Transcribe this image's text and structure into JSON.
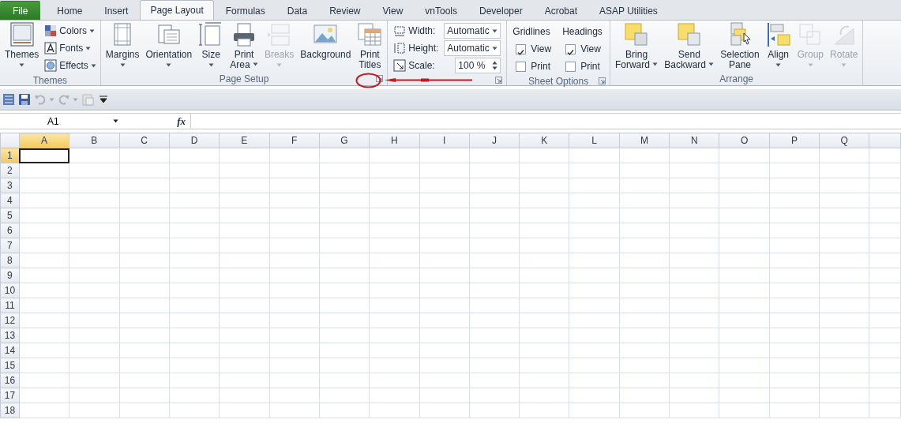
{
  "tabs": [
    {
      "label": "File",
      "kind": "file",
      "selected": false
    },
    {
      "label": "Home",
      "kind": "tab",
      "selected": false
    },
    {
      "label": "Insert",
      "kind": "tab",
      "selected": false
    },
    {
      "label": "Page Layout",
      "kind": "tab",
      "selected": true
    },
    {
      "label": "Formulas",
      "kind": "tab",
      "selected": false
    },
    {
      "label": "Data",
      "kind": "tab",
      "selected": false
    },
    {
      "label": "Review",
      "kind": "tab",
      "selected": false
    },
    {
      "label": "View",
      "kind": "tab",
      "selected": false
    },
    {
      "label": "vnTools",
      "kind": "tab",
      "selected": false
    },
    {
      "label": "Developer",
      "kind": "tab",
      "selected": false
    },
    {
      "label": "Acrobat",
      "kind": "tab",
      "selected": false
    },
    {
      "label": "ASAP Utilities",
      "kind": "tab",
      "selected": false
    }
  ],
  "ribbon": {
    "groups": [
      {
        "label": "Themes",
        "launcher": false,
        "items": [
          {
            "kind": "large",
            "lines": [
              "Themes"
            ],
            "dropdown": true,
            "disabled": false
          },
          {
            "kind": "stack",
            "buttons": [
              {
                "label": "Colors",
                "dropdown": true
              },
              {
                "label": "Fonts",
                "dropdown": true
              },
              {
                "label": "Effects",
                "dropdown": true
              }
            ]
          }
        ]
      },
      {
        "label": "Page Setup",
        "launcher": true,
        "items": [
          {
            "kind": "large",
            "lines": [
              "Margins"
            ],
            "dropdown": true,
            "disabled": false
          },
          {
            "kind": "large",
            "lines": [
              "Orientation"
            ],
            "dropdown": true,
            "disabled": false
          },
          {
            "kind": "large",
            "lines": [
              "Size"
            ],
            "dropdown": true,
            "disabled": false
          },
          {
            "kind": "large",
            "lines": [
              "Print",
              "Area"
            ],
            "dropdown": true,
            "disabled": false
          },
          {
            "kind": "large",
            "lines": [
              "Breaks"
            ],
            "dropdown": true,
            "disabled": true
          },
          {
            "kind": "large",
            "lines": [
              "Background"
            ],
            "dropdown": false,
            "disabled": false
          },
          {
            "kind": "large",
            "lines": [
              "Print",
              "Titles"
            ],
            "dropdown": false,
            "disabled": false
          }
        ]
      },
      {
        "launcher": true,
        "items": [
          {
            "kind": "fields",
            "rows": [
              {
                "label": "Width:",
                "value": "Automatic",
                "kind": "dropdown"
              },
              {
                "label": "Height:",
                "value": "Automatic",
                "kind": "dropdown"
              },
              {
                "label": "Scale:",
                "value": "100 %",
                "kind": "spinner"
              }
            ]
          }
        ]
      },
      {
        "label": "Sheet Options",
        "launcher": true,
        "items": [
          {
            "kind": "options",
            "heading": "Gridlines",
            "options": [
              {
                "label": "View",
                "checked": true
              },
              {
                "label": "Print",
                "checked": false
              }
            ]
          },
          {
            "kind": "options",
            "heading": "Headings",
            "options": [
              {
                "label": "View",
                "checked": true
              },
              {
                "label": "Print",
                "checked": false
              }
            ]
          }
        ]
      },
      {
        "label": "Arrange",
        "launcher": false,
        "items": [
          {
            "kind": "large",
            "lines": [
              "Bring",
              "Forward"
            ],
            "dropdown": true,
            "disabled": false
          },
          {
            "kind": "large",
            "lines": [
              "Send",
              "Backward"
            ],
            "dropdown": true,
            "disabled": false
          },
          {
            "kind": "large",
            "lines": [
              "Selection",
              "Pane"
            ],
            "dropdown": false,
            "disabled": false
          },
          {
            "kind": "large",
            "lines": [
              "Align"
            ],
            "dropdown": true,
            "disabled": false
          },
          {
            "kind": "large",
            "lines": [
              "Group"
            ],
            "dropdown": true,
            "disabled": true
          },
          {
            "kind": "large",
            "lines": [
              "Rotate"
            ],
            "dropdown": true,
            "disabled": true
          }
        ]
      }
    ]
  },
  "quick_access": [
    {
      "disabled": false
    },
    {
      "disabled": false
    },
    {
      "disabled": true
    },
    {
      "disabled": true
    },
    {
      "disabled": true
    },
    {
      "disabled": false
    }
  ],
  "formula_bar": {
    "name_box": "A1",
    "function_label": "fx"
  },
  "sheet": {
    "columns": [
      {
        "label": "A",
        "selected": true
      },
      {
        "label": "B",
        "selected": false
      },
      {
        "label": "C",
        "selected": false
      },
      {
        "label": "D",
        "selected": false
      },
      {
        "label": "E",
        "selected": false
      },
      {
        "label": "F",
        "selected": false
      },
      {
        "label": "G",
        "selected": false
      },
      {
        "label": "H",
        "selected": false
      },
      {
        "label": "I",
        "selected": false
      },
      {
        "label": "J",
        "selected": false
      },
      {
        "label": "K",
        "selected": false
      },
      {
        "label": "L",
        "selected": false
      },
      {
        "label": "M",
        "selected": false
      },
      {
        "label": "N",
        "selected": false
      },
      {
        "label": "O",
        "selected": false
      },
      {
        "label": "P",
        "selected": false
      },
      {
        "label": "Q",
        "selected": false
      }
    ],
    "rows": [
      {
        "label": "1",
        "selected": true
      },
      {
        "label": "2",
        "selected": false
      },
      {
        "label": "3",
        "selected": false
      },
      {
        "label": "4",
        "selected": false
      },
      {
        "label": "5",
        "selected": false
      },
      {
        "label": "6",
        "selected": false
      },
      {
        "label": "7",
        "selected": false
      },
      {
        "label": "8",
        "selected": false
      },
      {
        "label": "9",
        "selected": false
      },
      {
        "label": "10",
        "selected": false
      },
      {
        "label": "11",
        "selected": false
      },
      {
        "label": "12",
        "selected": false
      },
      {
        "label": "13",
        "selected": false
      },
      {
        "label": "14",
        "selected": false
      },
      {
        "label": "15",
        "selected": false
      },
      {
        "label": "16",
        "selected": false
      },
      {
        "label": "17",
        "selected": false
      },
      {
        "label": "18",
        "selected": false
      }
    ]
  }
}
